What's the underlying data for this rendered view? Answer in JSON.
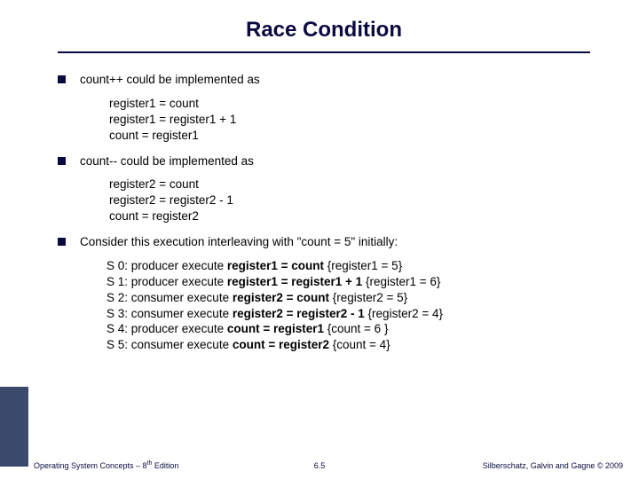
{
  "title": "Race Condition",
  "bullets": {
    "b1": "count++ could be implemented as",
    "b2": "count-- could be implemented as",
    "b3": "Consider this execution interleaving with \"count = 5\" initially:"
  },
  "sub1": {
    "l1": "register1 = count",
    "l2": "register1 = register1 + 1",
    "l3": "count = register1"
  },
  "sub2": {
    "l1": "register2 = count",
    "l2": "register2 = register2 - 1",
    "l3": "count = register2"
  },
  "trace": {
    "s0a": "S 0: producer execute ",
    "s0b": "register1 = count   ",
    "s0c": "{register1 = 5}",
    "s1a": "S 1: producer execute ",
    "s1b": "register1 = register1 + 1   ",
    "s1c": "{register1 = 6}",
    "s2a": "S 2: consumer execute ",
    "s2b": "register2 = count   ",
    "s2c": "{register2 = 5}",
    "s3a": "S 3: consumer execute ",
    "s3b": "register2 = register2 - 1   ",
    "s3c": "{register2 = 4}",
    "s4a": "S 4: producer execute ",
    "s4b": "count = register1   ",
    "s4c": "{count = 6 }",
    "s5a": "S 5: consumer execute ",
    "s5b": "count = register2   ",
    "s5c": "{count = 4}"
  },
  "footer": {
    "left_a": "Operating System Concepts – 8",
    "left_b": " Edition",
    "left_sup": "th",
    "mid": "6.5",
    "right": "Silberschatz, Galvin and Gagne © 2009"
  }
}
